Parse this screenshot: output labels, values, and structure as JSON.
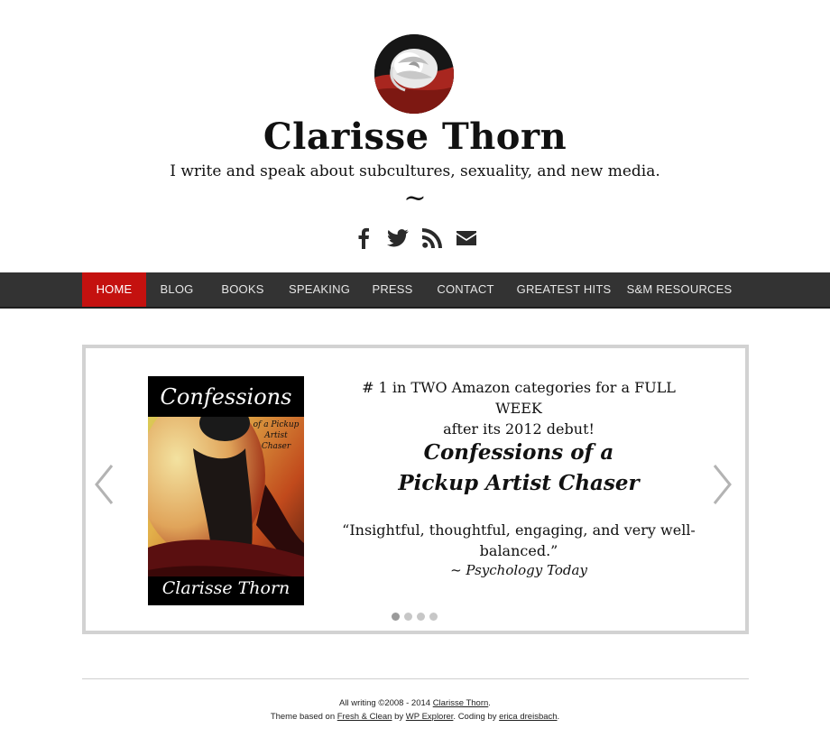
{
  "header": {
    "title": "Clarisse Thorn",
    "tagline": "I write and speak about subcultures, sexuality, and new media.",
    "tilde": "~",
    "social": [
      "facebook-icon",
      "twitter-icon",
      "rss-icon",
      "email-icon"
    ]
  },
  "nav": {
    "items": [
      {
        "label": "HOME",
        "active": true
      },
      {
        "label": "BLOG"
      },
      {
        "label": "BOOKS"
      },
      {
        "label": "SPEAKING"
      },
      {
        "label": "PRESS"
      },
      {
        "label": "CONTACT"
      },
      {
        "label": "GREATEST HITS"
      },
      {
        "label": "S&M RESOURCES"
      }
    ],
    "active_color": "#c4110f",
    "bar_color": "#333333"
  },
  "slider": {
    "book_cover": {
      "title": "Confessions",
      "subtitle_line1": "of a Pickup",
      "subtitle_line2": "Artist",
      "subtitle_line3": "Chaser",
      "author": "Clarisse Thorn"
    },
    "top_line1": "# 1 in TWO Amazon categories for a FULL WEEK",
    "top_line2": "after its 2012 debut!",
    "title_line1": "Confessions of a",
    "title_line2": "Pickup Artist Chaser",
    "quote_line1": "“Insightful, thoughtful, engaging, and very well-",
    "quote_line2": "balanced.”",
    "source": "~ Psychology Today",
    "dots": 4,
    "active_dot": 0
  },
  "footer": {
    "line1_prefix": "All writing ©2008 - 2014 ",
    "line1_link": "Clarisse Thorn",
    "line1_suffix": ".",
    "line2_prefix": "Theme based on ",
    "line2_link1": "Fresh & Clean",
    "line2_mid1": " by ",
    "line2_link2": "WP Explorer",
    "line2_mid2": ". Coding by ",
    "line2_link3": "erica dreisbach",
    "line2_suffix": "."
  }
}
